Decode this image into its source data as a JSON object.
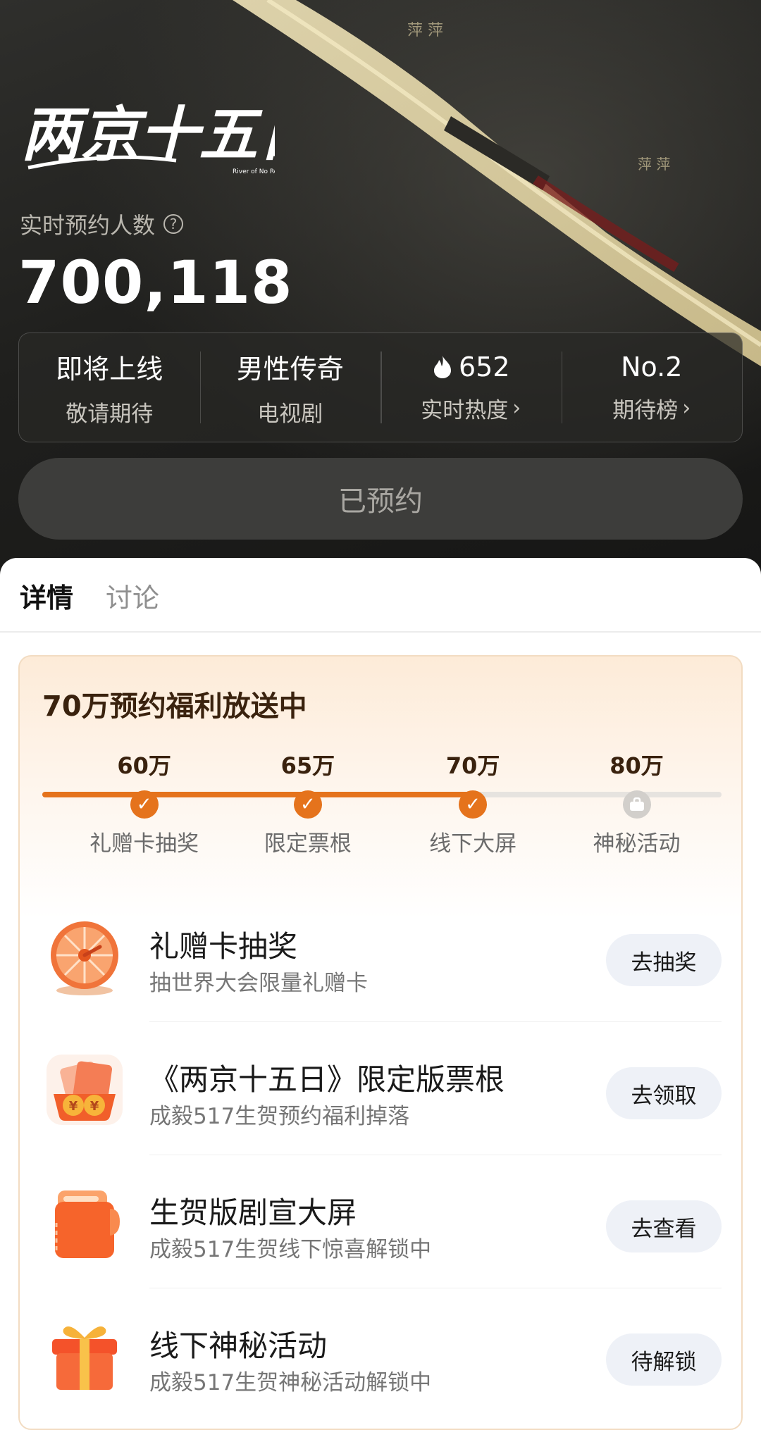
{
  "hero": {
    "title_logo": "两京十五日",
    "logo_subtext": "River of No Return",
    "count_label": "实时预约人数",
    "count_value": "700,118",
    "stats": [
      {
        "top": "即将上线",
        "sub": "敬请期待"
      },
      {
        "top": "男性传奇",
        "sub": "电视剧"
      },
      {
        "top": "652",
        "sub": "实时热度",
        "icon": "flame-icon"
      },
      {
        "top": "No.2",
        "sub": "期待榜"
      }
    ],
    "reserve_button": "已预约"
  },
  "tabs": [
    "详情",
    "讨论"
  ],
  "benefits": {
    "title": "70万预约福利放送中",
    "progress_fraction": 0.634,
    "milestones": [
      {
        "value": "60万",
        "label": "礼赠卡抽奖",
        "status": "done"
      },
      {
        "value": "65万",
        "label": "限定票根",
        "status": "done"
      },
      {
        "value": "70万",
        "label": "线下大屏",
        "status": "done"
      },
      {
        "value": "80万",
        "label": "神秘活动",
        "status": "locked"
      }
    ],
    "items": [
      {
        "title": "礼赠卡抽奖",
        "subtitle": "抽世界大会限量礼赠卡",
        "button": "去抽奖",
        "icon": "prize-wheel-icon"
      },
      {
        "title": "《两京十五日》限定版票根",
        "subtitle": "成毅517生贺预约福利掉落",
        "button": "去领取",
        "icon": "ticket-coins-icon"
      },
      {
        "title": "生贺版剧宣大屏",
        "subtitle": "成毅517生贺线下惊喜解锁中",
        "button": "去查看",
        "icon": "screen-card-icon"
      },
      {
        "title": "线下神秘活动",
        "subtitle": "成毅517生贺神秘活动解锁中",
        "button": "待解锁",
        "icon": "gift-box-icon"
      }
    ]
  },
  "colors": {
    "accent": "#e5731c",
    "locked": "#d2cfcb",
    "hero_bg": "#1f1f1d"
  }
}
